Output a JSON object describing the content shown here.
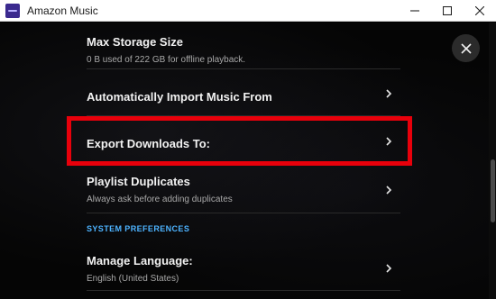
{
  "window": {
    "title": "Amazon Music",
    "minimize_icon": "minimize-icon",
    "maximize_icon": "maximize-icon",
    "close_icon": "close-icon"
  },
  "settings": [
    {
      "title": "Max Storage Size",
      "subtitle": "0 B used of 222 GB for offline playback.",
      "has_chevron": false
    },
    {
      "title": "Automatically Import Music From",
      "subtitle": "",
      "has_chevron": true
    },
    {
      "title": "Export Downloads To:",
      "subtitle": "",
      "has_chevron": true,
      "highlighted": true
    },
    {
      "title": "Playlist Duplicates",
      "subtitle": "Always ask before adding duplicates",
      "has_chevron": true
    },
    {
      "title": "Manage Language:",
      "subtitle": "English (United States)",
      "has_chevron": true
    }
  ],
  "sections": {
    "system_preferences": "SYSTEM PREFERENCES"
  },
  "colors": {
    "accent": "#4db3ff",
    "highlight_border": "#e8000b",
    "background": "#050505"
  }
}
